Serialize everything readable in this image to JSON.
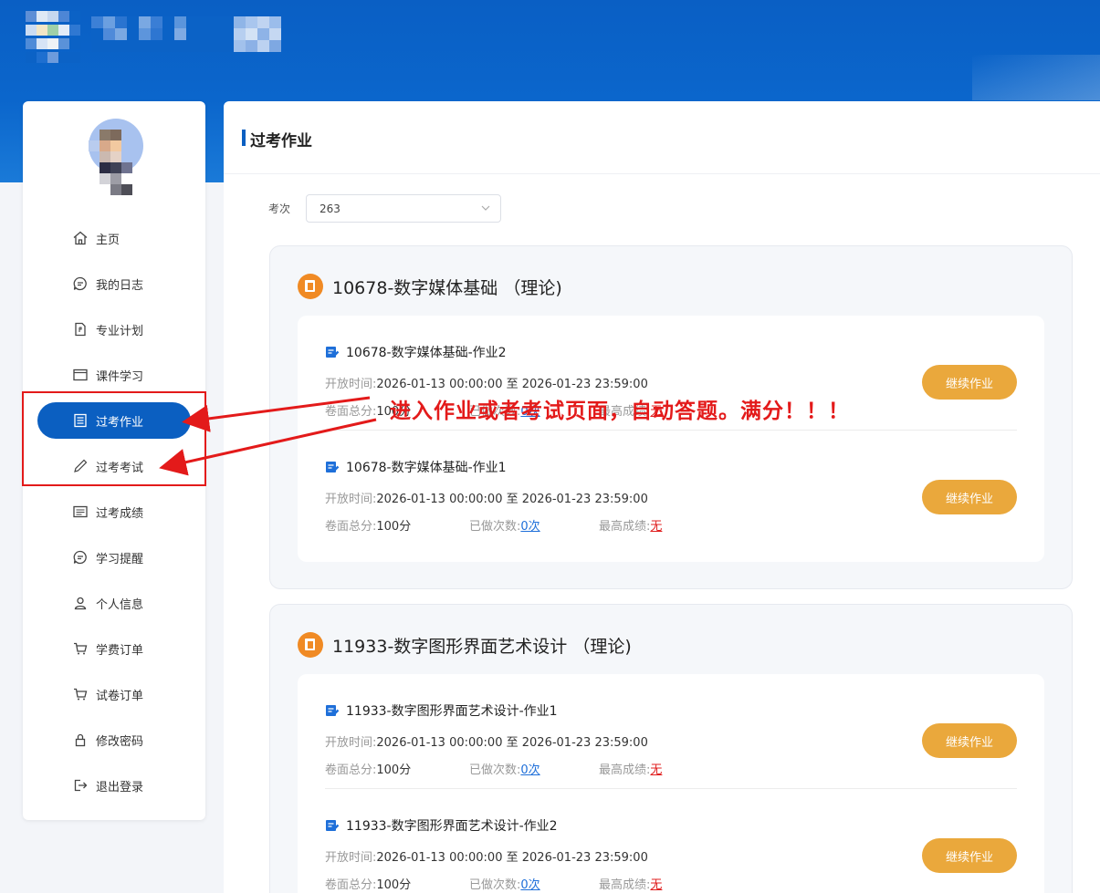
{
  "sidebar": {
    "items": [
      {
        "label": "主页",
        "icon": "home-icon"
      },
      {
        "label": "我的日志",
        "icon": "chat-icon"
      },
      {
        "label": "专业计划",
        "icon": "document-icon"
      },
      {
        "label": "课件学习",
        "icon": "window-icon"
      },
      {
        "label": "过考作业",
        "icon": "list-icon",
        "active": true
      },
      {
        "label": "过考考试",
        "icon": "pen-icon"
      },
      {
        "label": "过考成绩",
        "icon": "grades-icon"
      },
      {
        "label": "学习提醒",
        "icon": "chat-icon"
      },
      {
        "label": "个人信息",
        "icon": "user-icon"
      },
      {
        "label": "学费订单",
        "icon": "cart-icon"
      },
      {
        "label": "试卷订单",
        "icon": "cart-icon"
      },
      {
        "label": "修改密码",
        "icon": "lock-icon"
      },
      {
        "label": "退出登录",
        "icon": "logout-icon"
      }
    ]
  },
  "main": {
    "title": "过考作业",
    "filter_label": "考次",
    "filter_value": "263"
  },
  "labels": {
    "open_time": "开放时间:",
    "to": "至",
    "total": "卷面总分:",
    "done": "已做次数:",
    "best": "最高成绩:",
    "continue": "继续作业"
  },
  "courses": [
    {
      "name": "10678-数字媒体基础 （理论)",
      "homeworks": [
        {
          "title": "10678-数字媒体基础-作业2",
          "start": "2026-01-13 00:00:00",
          "end": "2026-01-23 23:59:00",
          "score": "100分",
          "done": "0次",
          "best": "无"
        },
        {
          "title": "10678-数字媒体基础-作业1",
          "start": "2026-01-13 00:00:00",
          "end": "2026-01-23 23:59:00",
          "score": "100分",
          "done": "0次",
          "best": "无"
        }
      ]
    },
    {
      "name": "11933-数字图形界面艺术设计 （理论)",
      "homeworks": [
        {
          "title": "11933-数字图形界面艺术设计-作业1",
          "start": "2026-01-13 00:00:00",
          "end": "2026-01-23 23:59:00",
          "score": "100分",
          "done": "0次",
          "best": "无"
        },
        {
          "title": "11933-数字图形界面艺术设计-作业2",
          "start": "2026-01-13 00:00:00",
          "end": "2026-01-23 23:59:00",
          "score": "100分",
          "done": "0次",
          "best": "无"
        }
      ]
    }
  ],
  "annotation": {
    "text": "进入作业或者考试页面，自动答题。满分！！！",
    "color": "#e31a1a"
  },
  "colors": {
    "primary": "#0b5fc1",
    "button": "#eaa83c",
    "course_icon": "#f08a24"
  }
}
